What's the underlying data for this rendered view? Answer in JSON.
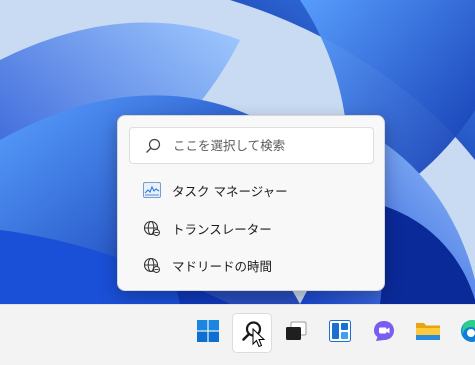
{
  "search_popup": {
    "placeholder": "ここを選択して検索",
    "items": [
      {
        "label": "タスク マネージャー",
        "icon": "task-manager-icon"
      },
      {
        "label": "トランスレーター",
        "icon": "globe-icon"
      },
      {
        "label": "マドリードの時間",
        "icon": "globe-icon"
      }
    ]
  },
  "taskbar": {
    "buttons": [
      {
        "name": "start",
        "icon": "windows-logo-icon"
      },
      {
        "name": "search",
        "icon": "search-icon",
        "active": true
      },
      {
        "name": "task-view",
        "icon": "task-view-icon"
      },
      {
        "name": "widgets",
        "icon": "widgets-icon"
      },
      {
        "name": "chat",
        "icon": "teams-chat-icon"
      },
      {
        "name": "file-explorer",
        "icon": "folder-icon"
      },
      {
        "name": "edge",
        "icon": "edge-icon"
      }
    ]
  },
  "colors": {
    "accent": "#0067c0",
    "taskbar_bg": "#f3f3f3",
    "popup_bg": "#f8f8f8"
  }
}
